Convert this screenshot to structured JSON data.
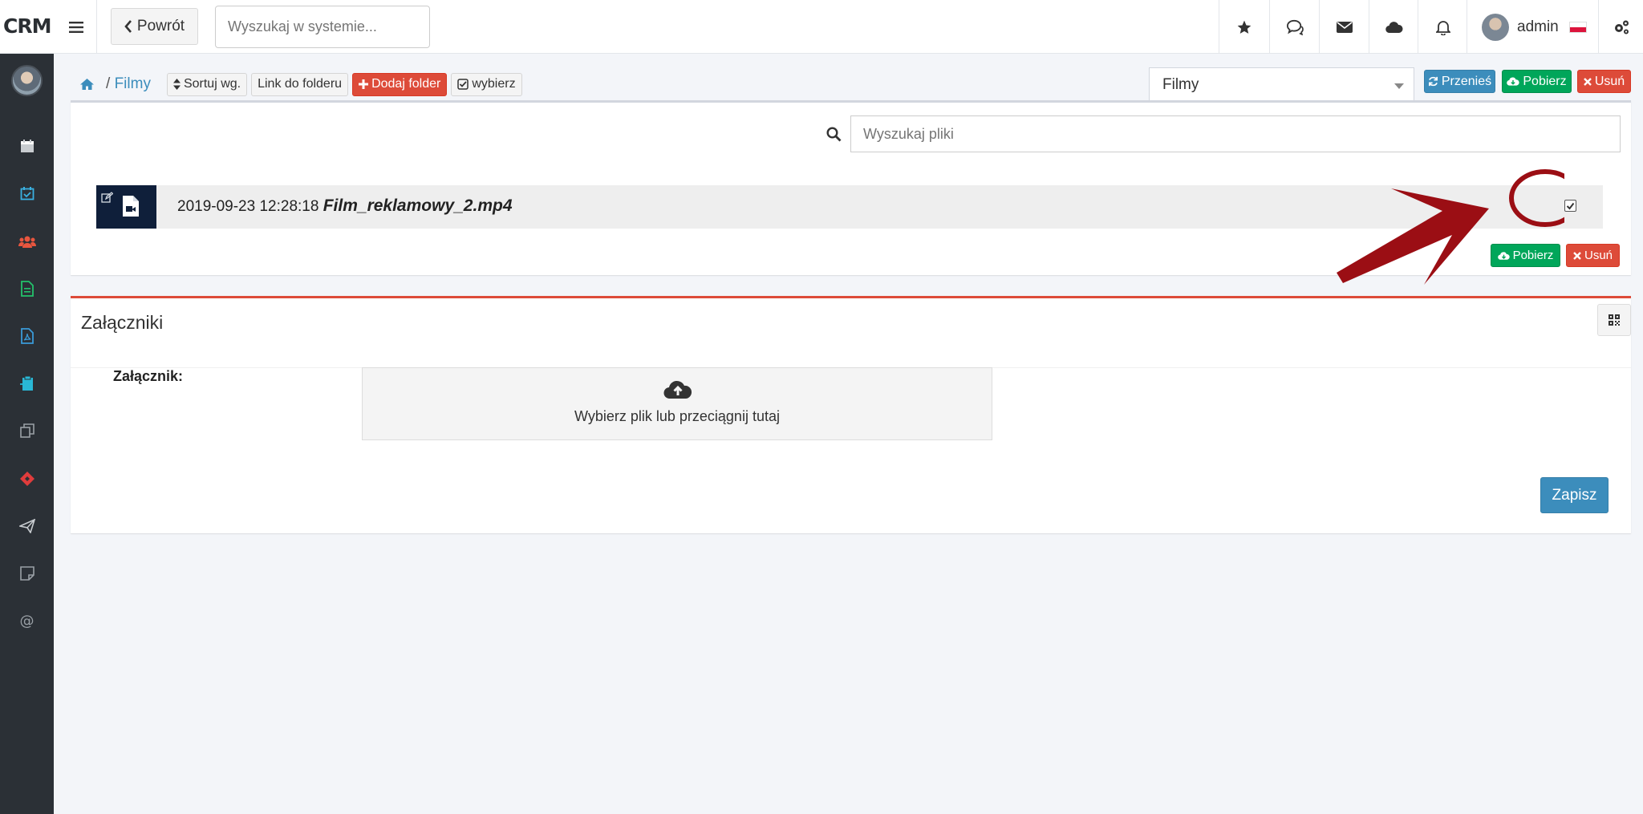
{
  "app": {
    "logo": "CRM"
  },
  "header": {
    "back_label": "Powrót",
    "search_placeholder": "Wyszukaj w systemie...",
    "user_name": "admin"
  },
  "toolbar": {
    "breadcrumb_sep": "/",
    "breadcrumb_current": "Filmy",
    "sort_label": "Sortuj wg.",
    "link_label": "Link do folderu",
    "add_folder_label": "Dodaj folder",
    "select_label": "wybierz"
  },
  "folder_select": {
    "value": "Filmy"
  },
  "actions": {
    "move_label": "Przenieś",
    "download_label": "Pobierz",
    "delete_label": "Usuń"
  },
  "files": {
    "search_placeholder": "Wyszukaj pliki",
    "items": [
      {
        "date": "2019-09-23 12:28:18",
        "name": "Film_reklamowy_2.mp4",
        "checked": true
      }
    ],
    "download_label": "Pobierz",
    "delete_label": "Usuń"
  },
  "attachments": {
    "title": "Załączniki",
    "field_label": "Załącznik:",
    "dropzone_text": "Wybierz plik  lub  przeciągnij tutaj",
    "save_label": "Zapisz"
  },
  "colors": {
    "primary": "#3c8dbc",
    "success": "#00a65a",
    "danger": "#dd4b39",
    "sidebar": "#2b3036",
    "annotation": "#9b0e14"
  }
}
